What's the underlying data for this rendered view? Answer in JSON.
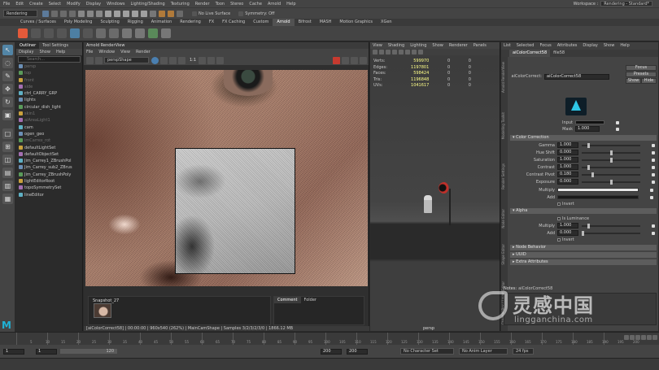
{
  "menubar": {
    "items": [
      "File",
      "Edit",
      "Create",
      "Select",
      "Modify",
      "Display",
      "Windows",
      "Lighting/Shading",
      "Texturing",
      "Render",
      "Toon",
      "Stereo",
      "Cache",
      "Arnold",
      "Help"
    ],
    "workspace_label": "Workspace :",
    "workspace_value": "Rendering - Standard*"
  },
  "statusline": {
    "mode": "Rendering",
    "live_surface": "No Live Surface",
    "symmetry": "Symmetry: Off"
  },
  "shelf": {
    "tabs": [
      "Curves / Surfaces",
      "Poly Modeling",
      "Sculpting",
      "Rigging",
      "Animation",
      "Rendering",
      "FX",
      "FX Caching",
      "Custom",
      "Arnold",
      "Bifrost",
      "MASH",
      "Motion Graphics",
      "XGen"
    ],
    "active_tab": "Arnold"
  },
  "outliner": {
    "tabs": [
      "Outliner",
      "Tool Settings"
    ],
    "menu": [
      "Display",
      "Show",
      "Help"
    ],
    "search_placeholder": "Search...",
    "items": [
      {
        "label": "persp",
        "dim": true
      },
      {
        "label": "top",
        "dim": true
      },
      {
        "label": "front",
        "dim": true
      },
      {
        "label": "side",
        "dim": true
      },
      {
        "label": "ctrl_CARRY_GRP",
        "dim": false
      },
      {
        "label": "lights",
        "dim": false
      },
      {
        "label": "circular_dish_light",
        "dim": false
      },
      {
        "label": "skin1",
        "dim": true
      },
      {
        "label": "aiAreaLight1",
        "dim": true
      },
      {
        "label": "cam",
        "dim": false
      },
      {
        "label": "ogen_geo",
        "dim": false
      },
      {
        "label": "imCarrex_rot",
        "dim": true
      },
      {
        "label": "defaultLightSet",
        "dim": false
      },
      {
        "label": "defaultObjectSet",
        "dim": false
      },
      {
        "label": "Jim_Carrey1_ZBrushPol",
        "dim": false
      },
      {
        "label": "Jim_Carrey_sub2_ZBrus",
        "dim": false
      },
      {
        "label": "Jim_Carrey_ZBrushPoly",
        "dim": false
      },
      {
        "label": "lightEditorRoot",
        "dim": false
      },
      {
        "label": "topoSymmetrySet",
        "dim": false
      },
      {
        "label": "lineEditor",
        "dim": false
      }
    ]
  },
  "renderview": {
    "title": "Arnold RenderView",
    "menu": [
      "File",
      "Window",
      "View",
      "Render"
    ],
    "camera": "perspShape",
    "ratio": "1:1",
    "snapshot_label": "Snapshot_27",
    "comment_tabs": [
      "Comment",
      "Folder"
    ],
    "status": "[aiColorCorrect58] | 00:00:00 | 960x540 (262%) | MainCamShape | Samples 3/2/3/2/3/0 | 1866.12 MB"
  },
  "viewport": {
    "menu": [
      "View",
      "Shading",
      "Lighting",
      "Show",
      "Renderer",
      "Panels"
    ],
    "hud": [
      {
        "k": "Verts:",
        "v": "599970",
        "a": "0",
        "b": "0"
      },
      {
        "k": "Edges:",
        "v": "1197801",
        "a": "0",
        "b": "0"
      },
      {
        "k": "Faces:",
        "v": "598424",
        "a": "0",
        "b": "0"
      },
      {
        "k": "Tris:",
        "v": "1196848",
        "a": "0",
        "b": "0"
      },
      {
        "k": "UVs:",
        "v": "1041617",
        "a": "0",
        "b": "0"
      }
    ],
    "camera_label": "persp"
  },
  "attr": {
    "menu": [
      "List",
      "Selected",
      "Focus",
      "Attributes",
      "Display",
      "Show",
      "Help"
    ],
    "node_tab": "aiColorCorrect58",
    "node_tab2": "file58",
    "type_label": "aiColorCorrect:",
    "node_name": "aiColorCorrect58",
    "focus_btn": "Focus",
    "presets_btn": "Presets",
    "show_btn": "Show",
    "hide_btn": "Hide",
    "side_tabs": [
      "Arnold RenderView",
      "Modelling Toolkit",
      "Render Settings",
      "Node Editor",
      "Shape Editor",
      "Channel Box / Layer Editor",
      "Hypershade"
    ],
    "input_label": "Input",
    "mask_label": "Mask",
    "mask_value": "1.000",
    "color_section": "Color Correction",
    "rows": [
      {
        "label": "Gamma",
        "value": "1.000",
        "frac": 0.1
      },
      {
        "label": "Hue Shift",
        "value": "0.000",
        "frac": 0.5
      },
      {
        "label": "Saturation",
        "value": "1.000",
        "frac": 0.5
      },
      {
        "label": "Contrast",
        "value": "1.000",
        "frac": 0.1
      },
      {
        "label": "Contrast Pivot",
        "value": "0.180",
        "frac": 0.18
      },
      {
        "label": "Exposure",
        "value": "0.000",
        "frac": 0.5
      }
    ],
    "multiply_label": "Multiply",
    "add_label": "Add",
    "invert_label": "Invert",
    "alpha_section": "Alpha",
    "is_luminance": "Is Luminance",
    "alpha_multiply": "1.000",
    "alpha_add": "0.000",
    "collapsed": [
      "Node Behavior",
      "UUID",
      "Extra Attributes"
    ],
    "notes_label": "Notes:",
    "notes_value": "aiColorCorrect58"
  },
  "timeline": {
    "ticks": [
      "5",
      "10",
      "15",
      "20",
      "25",
      "30",
      "35",
      "40",
      "45",
      "50",
      "55",
      "60",
      "65",
      "70",
      "75",
      "80",
      "85",
      "90",
      "95",
      "100",
      "105",
      "110",
      "115",
      "120",
      "125",
      "130",
      "135",
      "140",
      "145",
      "150",
      "155",
      "160",
      "165",
      "170",
      "175",
      "180",
      "185",
      "190",
      "195",
      "200"
    ],
    "start": "1",
    "start2": "1",
    "mid": "120",
    "end": "200",
    "end2": "200",
    "character_set": "No Character Set",
    "anim_layer": "No Anim Layer",
    "fps": "24 fps"
  },
  "app_logo": "M",
  "watermark": {
    "cn": "灵感中国",
    "en": "lingganchina.com"
  }
}
